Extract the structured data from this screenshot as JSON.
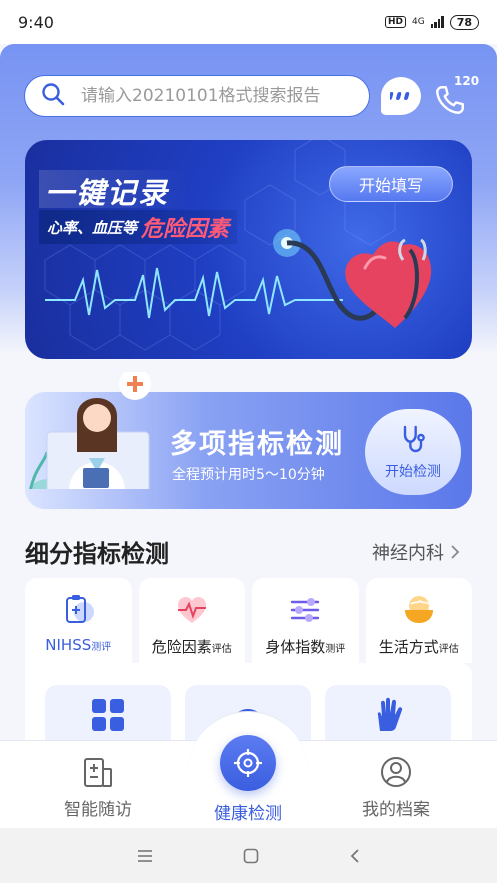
{
  "status_bar": {
    "time": "9:40",
    "hd": "HD",
    "network": "4G",
    "battery": "78"
  },
  "search": {
    "placeholder": "请输入20210101格式搜索报告"
  },
  "header": {
    "chat_icon": "chat-bubble-icon",
    "phone_icon": "phone-icon",
    "phone_badge": "120"
  },
  "banner": {
    "title": "一键记录",
    "subtitle_prefix": "心率、血压等",
    "subtitle_highlight": "危险因素",
    "button_label": "开始填写"
  },
  "multi_check": {
    "title": "多项指标检测",
    "subtitle": "全程预计用时5～10分钟",
    "button_label": "开始检测"
  },
  "section": {
    "title": "细分指标检测",
    "link_label": "神经内科"
  },
  "tabs": [
    {
      "label": "NIHSS",
      "suffix": "测评",
      "icon": "clipboard-icon"
    },
    {
      "label": "危险因素",
      "suffix": "评估",
      "icon": "heart-pulse-icon"
    },
    {
      "label": "身体指数",
      "suffix": "测评",
      "icon": "sliders-icon"
    },
    {
      "label": "生活方式",
      "suffix": "评估",
      "icon": "food-bowl-icon"
    }
  ],
  "tiles": [
    {
      "icon": "grid-icon"
    },
    {
      "icon": "face-icon"
    },
    {
      "icon": "hand-icon"
    }
  ],
  "bottom_nav": [
    {
      "label": "智能随访",
      "icon": "hospital-icon"
    },
    {
      "label": "健康检测",
      "icon": "target-icon"
    },
    {
      "label": "我的档案",
      "icon": "user-icon"
    }
  ],
  "colors": {
    "accent": "#3a5ee0",
    "highlight": "#ff5a78"
  }
}
